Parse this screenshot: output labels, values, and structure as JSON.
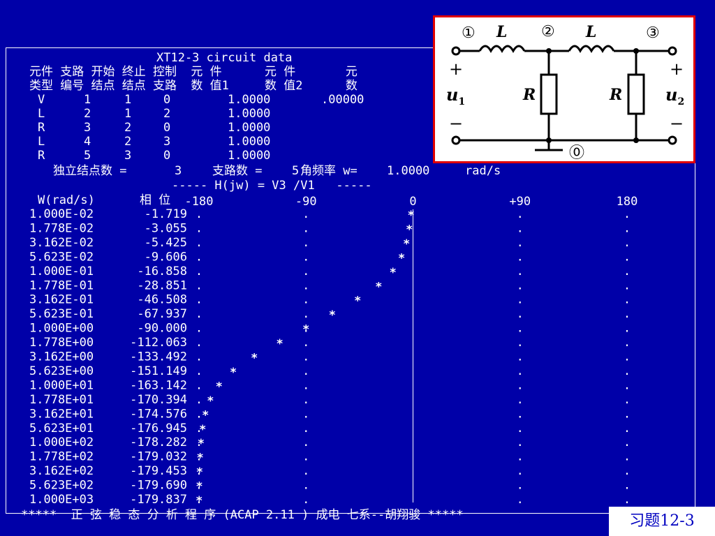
{
  "header": {
    "title": "XT12-3 circuit data",
    "col_labels_row1": "元件 支路 开始 终止 控制  元 件      元 件       元",
    "col_labels_row2": "类型 编号 结点 结点 支路  数 值1     数 值2      数"
  },
  "elements": [
    {
      "type": "V",
      "branch": "1",
      "start": "1",
      "end": "0",
      "value1": "1.0000",
      "value2": ".00000"
    },
    {
      "type": "L",
      "branch": "2",
      "start": "1",
      "end": "2",
      "value1": "1.0000",
      "value2": ""
    },
    {
      "type": "R",
      "branch": "3",
      "start": "2",
      "end": "0",
      "value1": "1.0000",
      "value2": ""
    },
    {
      "type": "L",
      "branch": "4",
      "start": "2",
      "end": "3",
      "value1": "1.0000",
      "value2": ""
    },
    {
      "type": "R",
      "branch": "5",
      "start": "3",
      "end": "0",
      "value1": "1.0000",
      "value2": ""
    }
  ],
  "summary": {
    "nodes_label": "独立结点数 =",
    "nodes_value": "3",
    "branches_label": "支路数 =",
    "branches_value": "5",
    "freq_label": "角频率 w=",
    "freq_value": "1.0000",
    "freq_unit": "rad/s"
  },
  "transfer_function": "----- H(jw) = V3 /V1   -----",
  "chart_data": {
    "type": "scatter",
    "title": "",
    "xlabel": "W(rad/s)",
    "ylabel": "相 位",
    "ylim": [
      -180,
      180
    ],
    "y_ticks": [
      "-180",
      "-90",
      "0",
      "+90",
      "180"
    ],
    "x": [
      "1.000E-02",
      "1.778E-02",
      "3.162E-02",
      "5.623E-02",
      "1.000E-01",
      "1.778E-01",
      "3.162E-01",
      "5.623E-01",
      "1.000E+00",
      "1.778E+00",
      "3.162E+00",
      "5.623E+00",
      "1.000E+01",
      "1.778E+01",
      "3.162E+01",
      "5.623E+01",
      "1.000E+02",
      "1.778E+02",
      "3.162E+02",
      "5.623E+02",
      "1.000E+03"
    ],
    "y": [
      -1.719,
      -3.055,
      -5.425,
      -9.606,
      -16.858,
      -28.851,
      -46.508,
      -67.937,
      -90.0,
      -112.063,
      -133.492,
      -151.149,
      -163.142,
      -170.394,
      -174.576,
      -176.945,
      -178.282,
      -179.032,
      -179.453,
      -179.69,
      -179.837
    ],
    "y_labels": [
      "-1.719",
      "-3.055",
      "-5.425",
      "-9.606",
      "-16.858",
      "-28.851",
      "-46.508",
      "-67.937",
      "-90.000",
      "-112.063",
      "-133.492",
      "-151.149",
      "-163.142",
      "-170.394",
      "-174.576",
      "-176.945",
      "-178.282",
      "-179.032",
      "-179.453",
      "-179.690",
      "-179.837"
    ],
    "marker": "*"
  },
  "footer": "*****  正 弦 稳 态 分 析 程 序 (ACAP 2.11 ) 成电 七系--胡翔骏 *****",
  "exercise_label": "习题12-3",
  "circuit": {
    "node1": "①",
    "node2": "②",
    "node3": "③",
    "node0": "⓪",
    "inductor_label": "L",
    "resistor_label": "R",
    "u1_label": "u",
    "u1_sub": "1",
    "u2_label": "u",
    "u2_sub": "2",
    "plus": "+",
    "minus": "−"
  },
  "colors": {
    "background": "#0000a8",
    "text": "#ffffff",
    "circuit_border": "#e00000",
    "label_text": "#0000c0"
  }
}
